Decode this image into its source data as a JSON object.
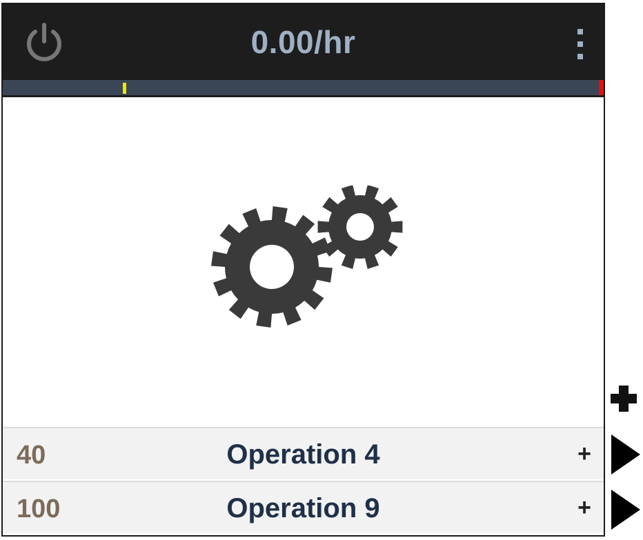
{
  "header": {
    "rate": "0.00/hr",
    "power_icon": "power-icon",
    "menu_icon": "vertical-ellipsis-icon"
  },
  "progress": {
    "marker_color": "#f2e600",
    "end_color": "#e01010",
    "marker_fraction": 0.2
  },
  "content": {
    "icon": "gears-icon",
    "icon_color": "#3a3a3a"
  },
  "operations": [
    {
      "quantity": "40",
      "name": "Operation 4",
      "add_label": "+"
    },
    {
      "quantity": "100",
      "name": "Operation 9",
      "add_label": "+"
    }
  ],
  "side_controls": {
    "add_icon": "plus-icon",
    "arrow_icon": "play-arrow-icon"
  },
  "colors": {
    "header_bg": "#1d1d1d",
    "rate_text": "#9fb0c4",
    "row_bg": "#f2f2f2",
    "op_name": "#1f3048",
    "qty_text": "#7d6b5a"
  }
}
